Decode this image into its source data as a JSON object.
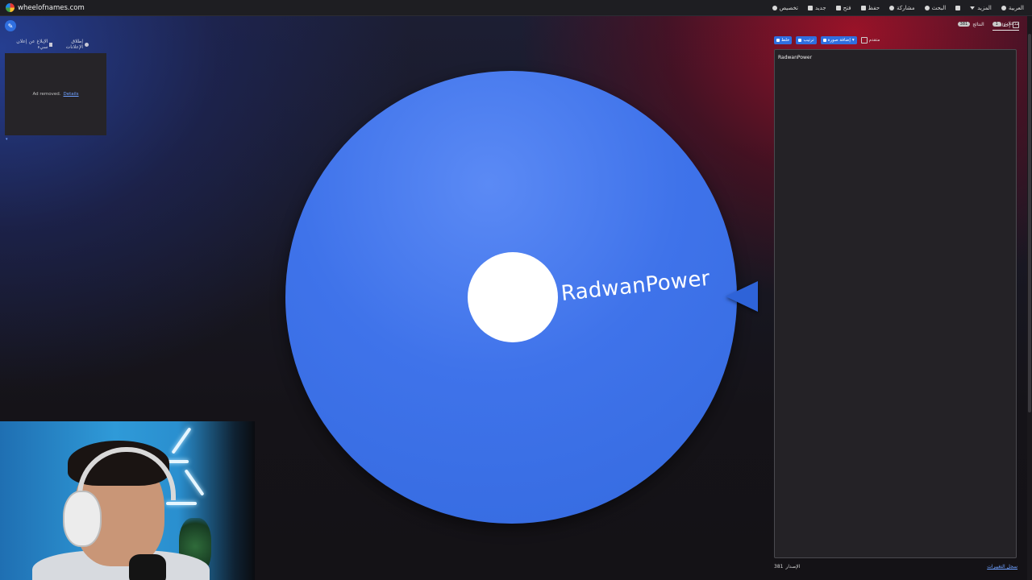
{
  "topbar": {
    "site_name": "wheelofnames.com",
    "menu": [
      {
        "label": "العربية",
        "icon": "globe-icon"
      },
      {
        "label": "المزيد",
        "icon": "chevron-down-icon"
      },
      {
        "label": "",
        "icon": "fullscreen-icon"
      },
      {
        "label": "البحث",
        "icon": "search-icon"
      },
      {
        "label": "مشاركة",
        "icon": "share-icon"
      },
      {
        "label": "حفظ",
        "icon": "save-icon"
      },
      {
        "label": "فتح",
        "icon": "folder-icon"
      },
      {
        "label": "جديد",
        "icon": "new-file-icon"
      },
      {
        "label": "تخصيص",
        "icon": "palette-icon"
      }
    ]
  },
  "left": {
    "links": [
      {
        "label": "إطلاق الإعلانات",
        "icon": "info-icon"
      },
      {
        "label": "الإبلاغ عن إعلان سيء",
        "icon": "flag-icon"
      }
    ],
    "ad": {
      "text": "Ad removed.",
      "link": "Details"
    }
  },
  "wheel": {
    "entry_label": "RadwanPower",
    "color": "#3f73ea",
    "pointer_color": "#2e63d8"
  },
  "panel": {
    "hide_label": "إخفاء",
    "tabs": [
      {
        "label": "مدخلات",
        "count": "1"
      },
      {
        "label": "النتائج",
        "count": "381"
      }
    ],
    "tools": {
      "shuffle": "خلط",
      "sort": "ترتيب",
      "add_image": "إضافة صورة",
      "advanced": "متقدم"
    },
    "entries": [
      "RadwanPower"
    ],
    "footer": {
      "version_label": "الإصدار",
      "version_number": "381",
      "changelog": "سجل التغييرات"
    }
  }
}
